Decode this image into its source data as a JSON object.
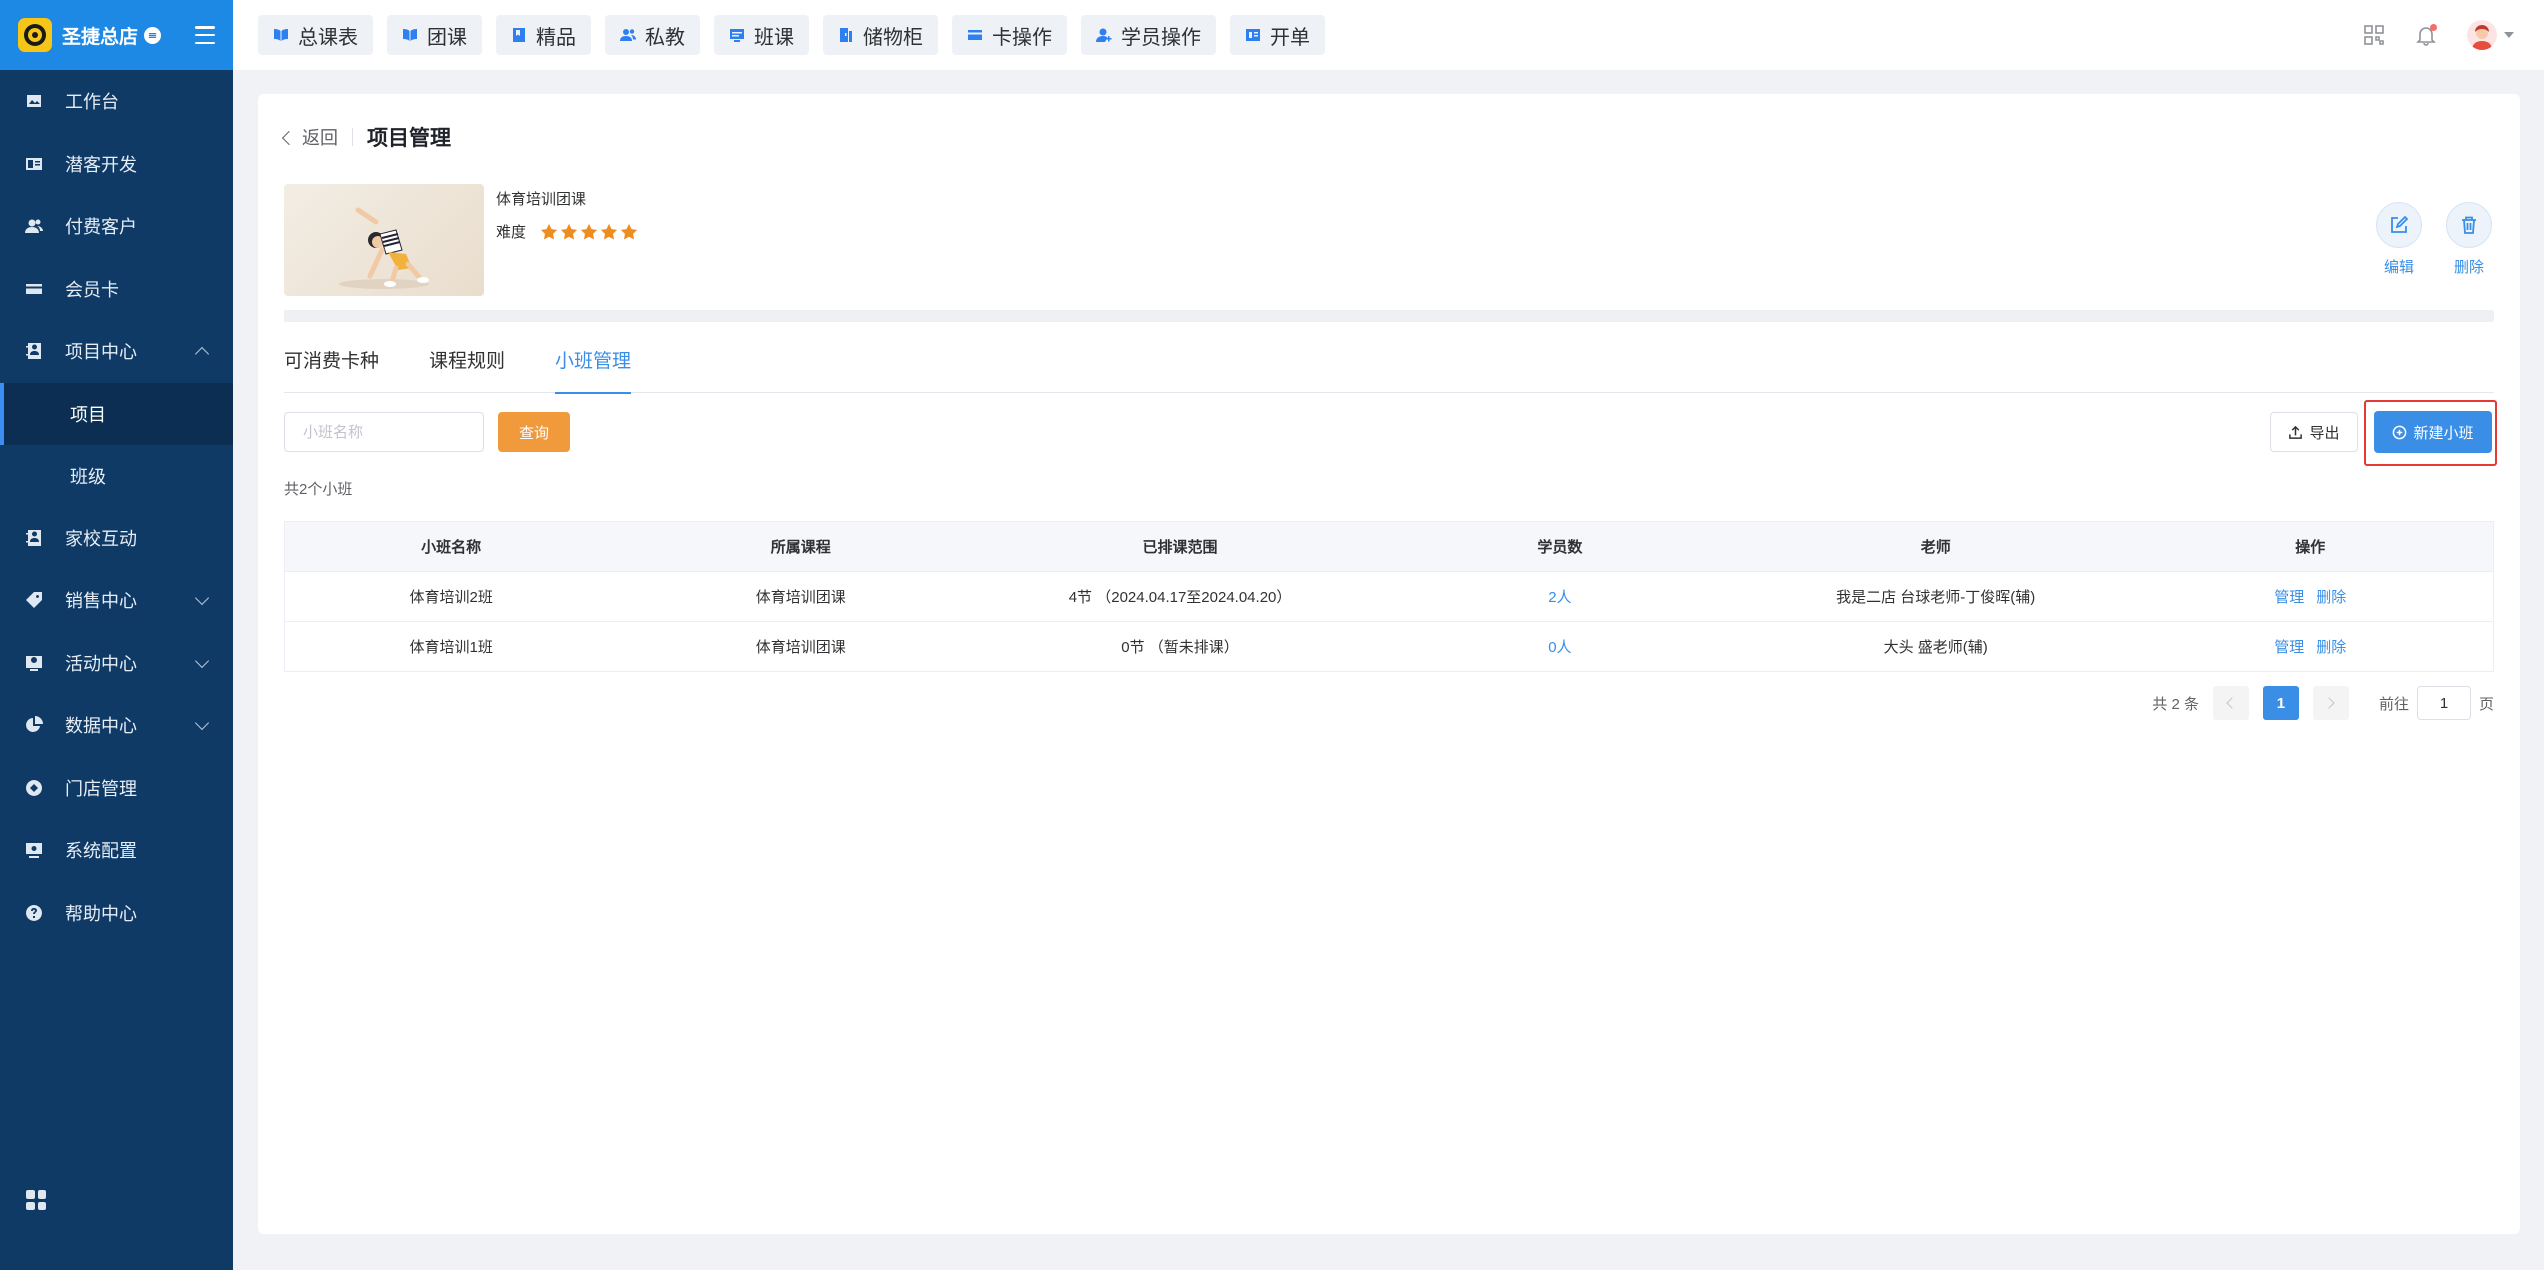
{
  "brand": {
    "name": "圣捷总店"
  },
  "sidebar": {
    "items": [
      {
        "label": "工作台",
        "icon": "image-icon"
      },
      {
        "label": "潜客开发",
        "icon": "id-card-icon"
      },
      {
        "label": "付费客户",
        "icon": "users-icon"
      },
      {
        "label": "会员卡",
        "icon": "card-icon"
      },
      {
        "label": "项目中心",
        "icon": "contact-book-icon",
        "expanded": true
      },
      {
        "label": "项目",
        "active": true
      },
      {
        "label": "班级"
      },
      {
        "label": "家校互动",
        "icon": "contact-book-icon"
      },
      {
        "label": "销售中心",
        "icon": "tag-icon"
      },
      {
        "label": "活动中心",
        "icon": "activity-icon"
      },
      {
        "label": "数据中心",
        "icon": "pie-chart-icon"
      },
      {
        "label": "门店管理",
        "icon": "store-icon"
      },
      {
        "label": "系统配置",
        "icon": "settings-icon"
      },
      {
        "label": "帮助中心",
        "icon": "help-icon"
      }
    ]
  },
  "topbar": {
    "buttons": [
      {
        "label": "总课表",
        "icon": "book-icon"
      },
      {
        "label": "团课",
        "icon": "book-icon"
      },
      {
        "label": "精品",
        "icon": "bookmark-icon"
      },
      {
        "label": "私教",
        "icon": "users-icon"
      },
      {
        "label": "班课",
        "icon": "board-icon"
      },
      {
        "label": "储物柜",
        "icon": "locker-icon"
      },
      {
        "label": "卡操作",
        "icon": "card-icon"
      },
      {
        "label": "学员操作",
        "icon": "user-icon"
      },
      {
        "label": "开单",
        "icon": "receipt-icon"
      }
    ]
  },
  "page": {
    "back_label": "返回",
    "title": "项目管理",
    "course_name": "体育培训团课",
    "difficulty_label": "难度",
    "difficulty_stars": 5,
    "edit_label": "编辑",
    "delete_label": "删除"
  },
  "tabs": [
    {
      "label": "可消费卡种",
      "active": false
    },
    {
      "label": "课程规则",
      "active": false
    },
    {
      "label": "小班管理",
      "active": true
    }
  ],
  "toolbar": {
    "search_placeholder": "小班名称",
    "query_label": "查询",
    "export_label": "导出",
    "new_label": "新建小班"
  },
  "summary": "共2个小班",
  "table": {
    "headers": [
      "小班名称",
      "所属课程",
      "已排课范围",
      "学员数",
      "老师",
      "操作"
    ],
    "rows": [
      {
        "name": "体育培训2班",
        "course": "体育培训团课",
        "range": "4节 （2024.04.17至2024.04.20）",
        "students": "2人",
        "teacher": "我是二店 台球老师-丁俊晖(辅)",
        "manage": "管理",
        "delete": "删除"
      },
      {
        "name": "体育培训1班",
        "course": "体育培训团课",
        "range": "0节 （暂未排课）",
        "students": "0人",
        "teacher": "大头 盛老师(辅)",
        "manage": "管理",
        "delete": "删除"
      }
    ]
  },
  "pagination": {
    "total": "共 2 条",
    "current": "1",
    "goto_prefix": "前往",
    "goto_value": "1",
    "goto_suffix": "页"
  },
  "colors": {
    "sidebar_bg": "#0f3a66",
    "brand_bg": "#1e88e5",
    "primary": "#3a8ee6",
    "query_orange": "#f09a3c",
    "star": "#f08c1e",
    "highlight_border": "#e53935"
  }
}
